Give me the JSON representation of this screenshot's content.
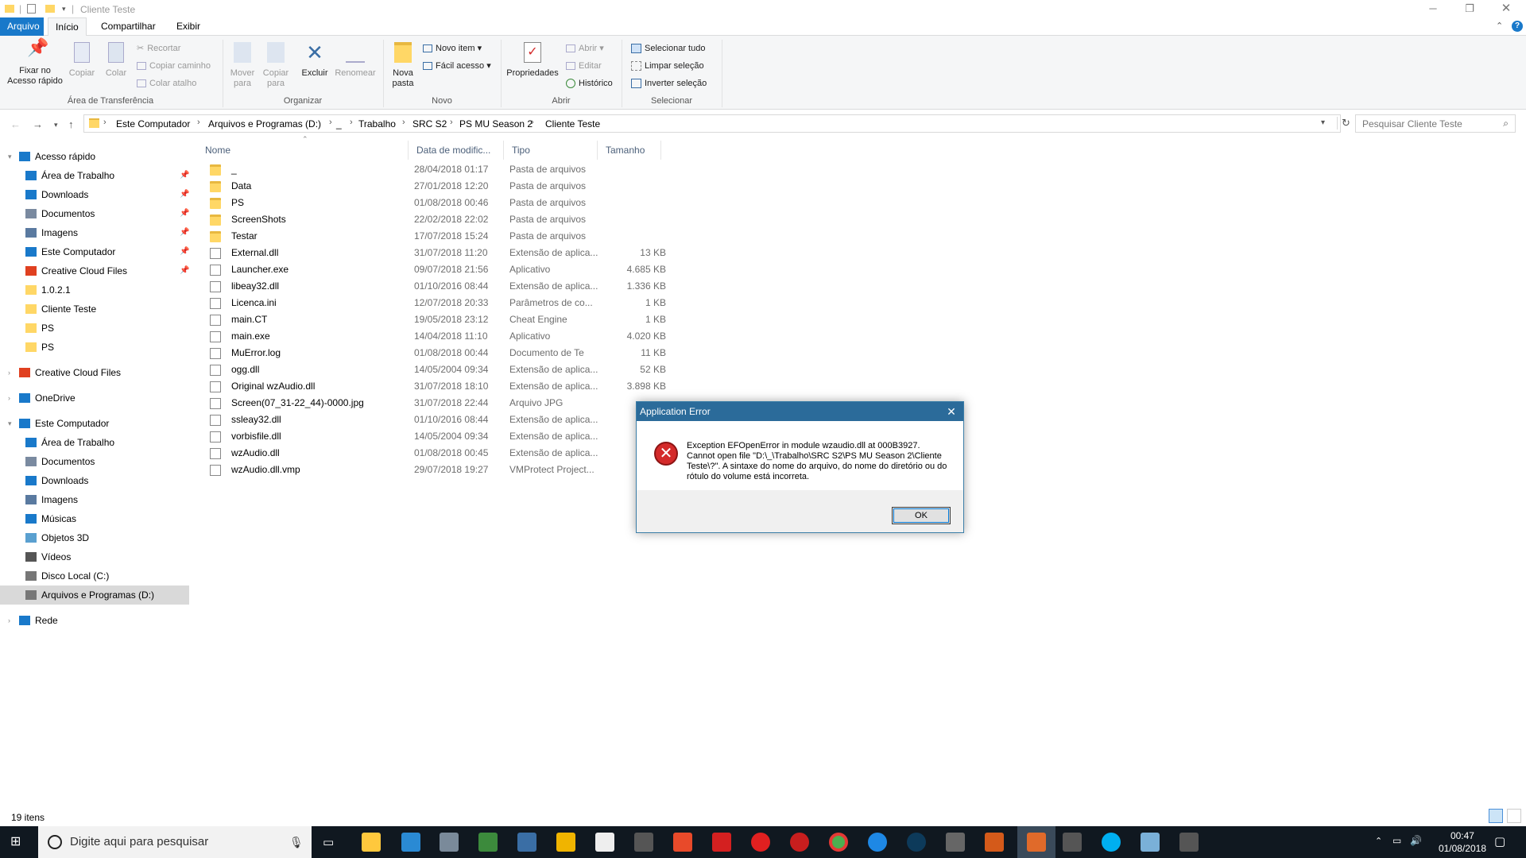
{
  "window": {
    "title": "Cliente Teste",
    "quick_access_separator": "|",
    "minimize_icon": "minimize-icon",
    "maximize_icon": "restore-icon",
    "close_icon": "close-icon"
  },
  "menu": {
    "tabs": [
      "Arquivo",
      "Início",
      "Compartilhar",
      "Exibir"
    ]
  },
  "ribbon": {
    "clipboard": {
      "group_label": "Área de Transferência",
      "pin_label": "Fixar no\nAcesso rápido",
      "copy_label": "Copiar",
      "paste_label": "Colar",
      "cut_label": "Recortar",
      "copy_path_label": "Copiar caminho",
      "paste_shortcut_label": "Colar atalho"
    },
    "organize": {
      "group_label": "Organizar",
      "move_label": "Mover\npara",
      "copy_to_label": "Copiar\npara",
      "delete_label": "Excluir",
      "rename_label": "Renomear"
    },
    "new": {
      "group_label": "Novo",
      "new_folder_label": "Nova\npasta",
      "new_item_label": "Novo item",
      "easy_access_label": "Fácil acesso"
    },
    "open": {
      "group_label": "Abrir",
      "properties_label": "Propriedades",
      "open_label": "Abrir",
      "edit_label": "Editar",
      "history_label": "Histórico"
    },
    "select": {
      "group_label": "Selecionar",
      "select_all_label": "Selecionar tudo",
      "select_none_label": "Limpar seleção",
      "invert_label": "Inverter seleção"
    }
  },
  "address": {
    "crumbs": [
      "Este Computador",
      "Arquivos e Programas (D:)",
      "_",
      "Trabalho",
      "SRC S2",
      "PS MU Season 2",
      "Cliente Teste"
    ],
    "search_placeholder": "Pesquisar Cliente Teste"
  },
  "nav": {
    "items": [
      {
        "label": "Acesso rápido",
        "icon": "star-icon"
      },
      {
        "label": "Área de Trabalho",
        "icon": "desktop-icon"
      },
      {
        "label": "Downloads",
        "icon": "download-icon"
      },
      {
        "label": "Documentos",
        "icon": "document-icon"
      },
      {
        "label": "Imagens",
        "icon": "image-icon"
      },
      {
        "label": "Este Computador",
        "icon": "computer-icon"
      },
      {
        "label": "Creative Cloud Files",
        "icon": "creative-cloud-icon"
      },
      {
        "label": "1.0.2.1",
        "icon": "folder-icon"
      },
      {
        "label": "Cliente Teste",
        "icon": "folder-icon"
      },
      {
        "label": "PS",
        "icon": "folder-icon"
      },
      {
        "label": "PS",
        "icon": "folder-icon"
      },
      {
        "label": "Creative Cloud Files",
        "icon": "creative-cloud-icon"
      },
      {
        "label": "OneDrive",
        "icon": "cloud-icon"
      },
      {
        "label": "Este Computador",
        "icon": "computer-icon"
      },
      {
        "label": "Área de Trabalho",
        "icon": "desktop-icon"
      },
      {
        "label": "Documentos",
        "icon": "document-icon"
      },
      {
        "label": "Downloads",
        "icon": "download-icon"
      },
      {
        "label": "Imagens",
        "icon": "image-icon"
      },
      {
        "label": "Músicas",
        "icon": "music-icon"
      },
      {
        "label": "Objetos 3D",
        "icon": "cube-icon"
      },
      {
        "label": "Vídeos",
        "icon": "video-icon"
      },
      {
        "label": "Disco Local (C:)",
        "icon": "drive-icon"
      },
      {
        "label": "Arquivos e Programas (D:)",
        "icon": "drive-icon"
      },
      {
        "label": "Rede",
        "icon": "network-icon"
      }
    ]
  },
  "columns": {
    "name": "Nome",
    "date": "Data de modific...",
    "type": "Tipo",
    "size": "Tamanho"
  },
  "files": [
    {
      "name": "_",
      "date": "28/04/2018 01:17",
      "type": "Pasta de arquivos",
      "size": ""
    },
    {
      "name": "Data",
      "date": "27/01/2018 12:20",
      "type": "Pasta de arquivos",
      "size": ""
    },
    {
      "name": "PS",
      "date": "01/08/2018 00:46",
      "type": "Pasta de arquivos",
      "size": ""
    },
    {
      "name": "ScreenShots",
      "date": "22/02/2018 22:02",
      "type": "Pasta de arquivos",
      "size": ""
    },
    {
      "name": "Testar",
      "date": "17/07/2018 15:24",
      "type": "Pasta de arquivos",
      "size": ""
    },
    {
      "name": "External.dll",
      "date": "31/07/2018 11:20",
      "type": "Extensão de aplica...",
      "size": "13 KB"
    },
    {
      "name": "Launcher.exe",
      "date": "09/07/2018 21:56",
      "type": "Aplicativo",
      "size": "4.685 KB"
    },
    {
      "name": "libeay32.dll",
      "date": "01/10/2016 08:44",
      "type": "Extensão de aplica...",
      "size": "1.336 KB"
    },
    {
      "name": "Licenca.ini",
      "date": "12/07/2018 20:33",
      "type": "Parâmetros de co...",
      "size": "1 KB"
    },
    {
      "name": "main.CT",
      "date": "19/05/2018 23:12",
      "type": "Cheat Engine",
      "size": "1 KB"
    },
    {
      "name": "main.exe",
      "date": "14/04/2018 11:10",
      "type": "Aplicativo",
      "size": "4.020 KB"
    },
    {
      "name": "MuError.log",
      "date": "01/08/2018 00:44",
      "type": "Documento de Te",
      "size": "11 KB"
    },
    {
      "name": "ogg.dll",
      "date": "14/05/2004 09:34",
      "type": "Extensão de aplica...",
      "size": "52 KB"
    },
    {
      "name": "Original wzAudio.dll",
      "date": "31/07/2018 18:10",
      "type": "Extensão de aplica...",
      "size": "3.898 KB"
    },
    {
      "name": "Screen(07_31-22_44)-0000.jpg",
      "date": "31/07/2018 22:44",
      "type": "Arquivo JPG",
      "size": ""
    },
    {
      "name": "ssleay32.dll",
      "date": "01/10/2016 08:44",
      "type": "Extensão de aplica...",
      "size": "3"
    },
    {
      "name": "vorbisfile.dll",
      "date": "14/05/2004 09:34",
      "type": "Extensão de aplica...",
      "size": "9"
    },
    {
      "name": "wzAudio.dll",
      "date": "01/08/2018 00:45",
      "type": "Extensão de aplica...",
      "size": "8.8"
    },
    {
      "name": "wzAudio.dll.vmp",
      "date": "29/07/2018 19:27",
      "type": "VMProtect Project...",
      "size": ""
    }
  ],
  "status": {
    "item_count": "19 itens"
  },
  "dialog": {
    "title": "Application Error",
    "message": "Exception EFOpenError in module wzaudio.dll at 000B3927.\nCannot open file \"D:\\_\\Trabalho\\SRC S2\\PS MU Season 2\\Cliente Teste\\?\". A sintaxe do nome do arquivo, do nome do diretório ou do rótulo do volume está incorreta.",
    "ok_label": "OK",
    "error_icon": "error-icon"
  },
  "taskbar": {
    "search_placeholder": "Digite aqui para pesquisar",
    "time": "00:47",
    "date": "01/08/2018"
  }
}
